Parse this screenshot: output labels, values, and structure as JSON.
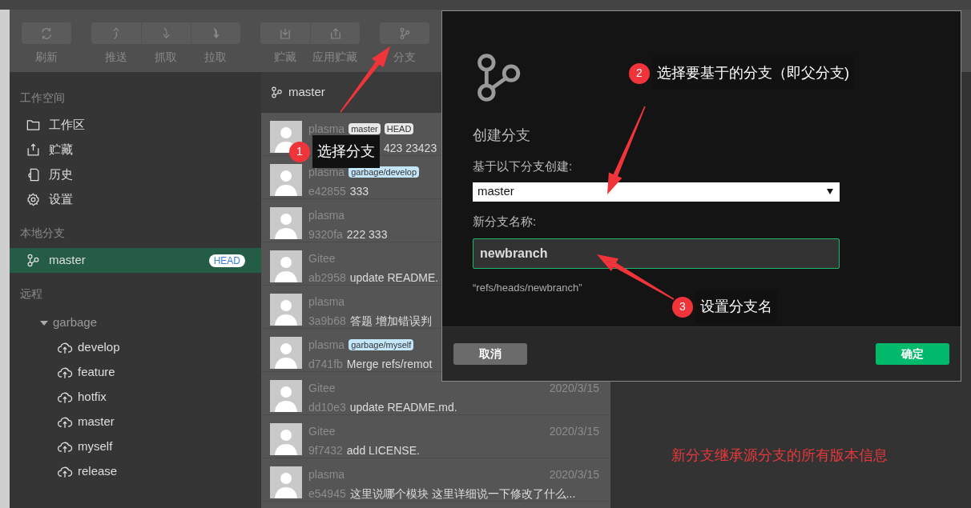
{
  "toolbar": {
    "groups": [
      [
        {
          "label": "刷新",
          "kind": "refresh"
        }
      ],
      [
        {
          "label": "推送",
          "kind": "push"
        },
        {
          "label": "抓取",
          "kind": "fetch"
        },
        {
          "label": "拉取",
          "kind": "pull"
        }
      ],
      [
        {
          "label": "贮藏",
          "kind": "stash"
        },
        {
          "label": "应用贮藏",
          "kind": "apply"
        }
      ],
      [
        {
          "label": "分支",
          "kind": "branch"
        }
      ]
    ]
  },
  "sidebar": {
    "workspace": {
      "heading": "工作空间",
      "items": [
        {
          "label": "工作区",
          "kind": "folder"
        },
        {
          "label": "贮藏",
          "kind": "stash"
        },
        {
          "label": "历史",
          "kind": "history"
        },
        {
          "label": "设置",
          "kind": "settings"
        }
      ]
    },
    "local": {
      "heading": "本地分支",
      "branches": [
        {
          "label": "master",
          "badge": "HEAD",
          "selected": true
        }
      ]
    },
    "remote": {
      "heading": "远程",
      "tree": [
        {
          "label": "garbage",
          "expanded": true,
          "children": [
            {
              "label": "develop"
            },
            {
              "label": "feature"
            },
            {
              "label": "hotfix"
            },
            {
              "label": "master"
            },
            {
              "label": "myself"
            },
            {
              "label": "release"
            }
          ]
        }
      ]
    }
  },
  "commits": {
    "branch": "master",
    "rows": [
      {
        "author": "plasma",
        "tags": [
          {
            "label": "master",
            "kind": "local"
          },
          {
            "label": "HEAD",
            "kind": "local"
          }
        ],
        "message": "423 23423"
      },
      {
        "author": "plasma",
        "tags": [
          {
            "label": "garbage/develop",
            "kind": "remote"
          }
        ],
        "hash": "e42855",
        "message": "333"
      },
      {
        "author": "plasma",
        "hash": "9320fa",
        "message": "222 333"
      },
      {
        "author": "Gitee",
        "hash": "ab2958",
        "message": "update README."
      },
      {
        "author": "plasma",
        "hash": "3a9b68",
        "message": "答题 增加错误判"
      },
      {
        "author": "plasma",
        "tags": [
          {
            "label": "garbage/myself",
            "kind": "remote"
          }
        ],
        "hash": "d741fb",
        "message": "Merge refs/remot"
      },
      {
        "author": "Gitee",
        "hash": "dd10e3",
        "message": "update README.md.",
        "date": "2020/3/15"
      },
      {
        "author": "Gitee",
        "hash": "9f7432",
        "message": "add LICENSE.",
        "date": "2020/3/15"
      },
      {
        "author": "plasma",
        "hash": "e54945",
        "message": "这里说哪个模块 这里详细说一下修改了什么...",
        "date": "2020/3/15"
      }
    ]
  },
  "dialog": {
    "title": "创建分支",
    "base_label": "基于以下分支创建:",
    "base_select": {
      "value": "master"
    },
    "name_label": "新分支名称:",
    "name_input": {
      "value": "newbranch"
    },
    "ref_hint": "“refs/heads/newbranch”",
    "buttons": [
      {
        "label": "取消",
        "kind": "cancel"
      },
      {
        "label": "确定",
        "kind": "confirm"
      }
    ]
  },
  "annotations": [
    {
      "number": "1",
      "text": "选择分支"
    },
    {
      "number": "2",
      "text": "选择要基于的分支（即父分支)"
    },
    {
      "number": "3",
      "text": "设置分支名"
    }
  ],
  "note": "新分支继承源分支的所有版本信息"
}
